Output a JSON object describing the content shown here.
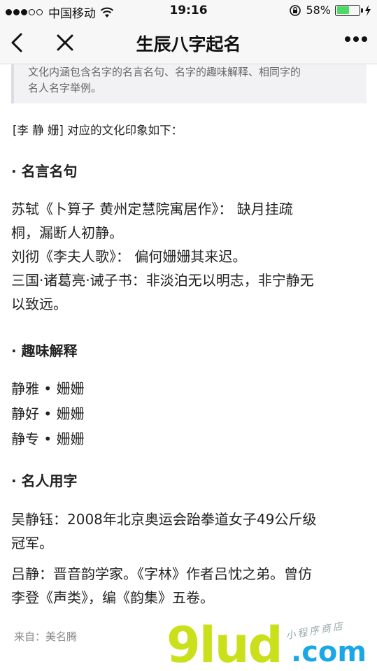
{
  "status_bar": {
    "carrier": "中国移动",
    "time": "19:16",
    "battery_percent": "58%",
    "battery_level": 0.58,
    "icons": [
      "signal-dots",
      "wifi-icon",
      "rotation-lock-icon",
      "battery-icon",
      "charging-icon"
    ]
  },
  "nav": {
    "title": "生辰八字起名",
    "icons": [
      "back-icon",
      "close-icon",
      "more-icon"
    ]
  },
  "notice": {
    "line1": "文化内涵包含名字的名言名句、名字的趣味解释、相同字的",
    "line2": "名人名字举例。"
  },
  "intro": "[李 静 姗] 对应的文化印象如下：",
  "sections": {
    "quotes": {
      "heading": "· 名言名句",
      "lines": [
        "苏轼《卜算子 黄州定慧院寓居作》：  缺月挂疏",
        "桐，漏断人初静。",
        "刘彻《李夫人歌》：  偏何姗姗其来迟。",
        "三国·诸葛亮·诫子书：非淡泊无以明志，非宁静无",
        "以致远。"
      ]
    },
    "fun": {
      "heading": "· 趣味解释",
      "lines": [
        "静雅 • 姗姗",
        "静好 • 姗姗",
        "静专 • 姗姗"
      ]
    },
    "famous": {
      "heading": "· 名人用字",
      "entry1": [
        "吴静钰：2008年北京奥运会跆拳道女子49公斤级",
        "冠军。"
      ],
      "entry2": [
        "吕静：晋音韵学家。《字林》作者吕忱之弟。曾仿",
        "李登《声类》，编《韵集》五卷。"
      ]
    }
  },
  "source": "来自：美名腾",
  "watermark": {
    "main": "9lud",
    "suffix": ".com",
    "tag": "小程序商店"
  },
  "colors": {
    "battery": "#4cd964",
    "watermark_green": "#c9e01a",
    "watermark_blue": "#1aa7e6"
  }
}
